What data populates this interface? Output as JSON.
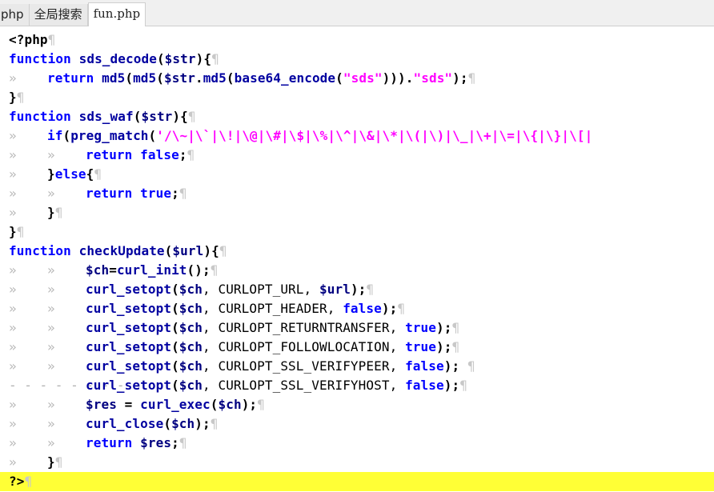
{
  "tabs": [
    {
      "label": "php"
    },
    {
      "label": "全局搜索"
    },
    {
      "label": "fun.php"
    }
  ],
  "markers": {
    "tab": "»",
    "eol": "¶",
    "dots": "- - - - - - - -"
  },
  "code": {
    "l1": {
      "a": "<?php"
    },
    "l2": {
      "a": "function",
      "b": " sds_decode",
      "c": "(",
      "d": "$str",
      "e": "){"
    },
    "l3": {
      "a": "return",
      "b": " md5",
      "c": "(",
      "d": "md5",
      "e": "(",
      "f": "$str",
      "g": ".",
      "h": "md5",
      "i": "(",
      "j": "base64_encode",
      "k": "(",
      "l": "\"sds\"",
      "m": "))).",
      "n": "\"sds\"",
      "o": ");"
    },
    "l4": {
      "a": "}"
    },
    "l5": {
      "a": "function",
      "b": " sds_waf",
      "c": "(",
      "d": "$str",
      "e": "){"
    },
    "l6": {
      "a": "if",
      "b": "(",
      "c": "preg_match",
      "d": "(",
      "e": "'/\\~|\\`|\\!|\\@|\\#|\\$|\\%|\\^|\\&|\\*|\\(|\\)|\\_|\\+|\\=|\\{|\\}|\\[|"
    },
    "l7": {
      "a": "return",
      "b": " false",
      "c": ";"
    },
    "l8": {
      "a": "}",
      "b": "else",
      "c": "{"
    },
    "l9": {
      "a": "return",
      "b": " true",
      "c": ";"
    },
    "l10": {
      "a": "}"
    },
    "l11": {
      "a": "}"
    },
    "l12": {
      "a": "function",
      "b": " checkUpdate",
      "c": "(",
      "d": "$url",
      "e": "){"
    },
    "l13": {
      "a": "$ch",
      "b": "=",
      "c": "curl_init",
      "d": "();"
    },
    "l14": {
      "a": "curl_setopt",
      "b": "(",
      "c": "$ch",
      "d": ", CURLOPT_URL, ",
      "e": "$url",
      "f": ");"
    },
    "l15": {
      "a": "curl_setopt",
      "b": "(",
      "c": "$ch",
      "d": ", CURLOPT_HEADER, ",
      "e": "false",
      "f": ");"
    },
    "l16": {
      "a": "curl_setopt",
      "b": "(",
      "c": "$ch",
      "d": ", CURLOPT_RETURNTRANSFER, ",
      "e": "true",
      "f": ");"
    },
    "l17": {
      "a": "curl_setopt",
      "b": "(",
      "c": "$ch",
      "d": ", CURLOPT_FOLLOWLOCATION, ",
      "e": "true",
      "f": ");"
    },
    "l18": {
      "a": "curl_setopt",
      "b": "(",
      "c": "$ch",
      "d": ", CURLOPT_SSL_VERIFYPEER, ",
      "e": "false",
      "f": "); "
    },
    "l19": {
      "a": "curl_setopt",
      "b": "(",
      "c": "$ch",
      "d": ", CURLOPT_SSL_VERIFYHOST, ",
      "e": "false",
      "f": ");"
    },
    "l20": {
      "a": "$res",
      "b": " = ",
      "c": "curl_exec",
      "d": "(",
      "e": "$ch",
      "f": ");"
    },
    "l21": {
      "a": "curl_close",
      "b": "(",
      "c": "$ch",
      "d": ");"
    },
    "l22": {
      "a": "return",
      "b": " $res",
      "c": ";"
    },
    "l23": {
      "a": "}"
    },
    "l24": {
      "a": "?>"
    }
  },
  "colors": {
    "keyword": "#0000ff",
    "function": "#0000a0",
    "variable": "#000080",
    "string": "#ff00ff",
    "current_line": "#ffff36"
  }
}
